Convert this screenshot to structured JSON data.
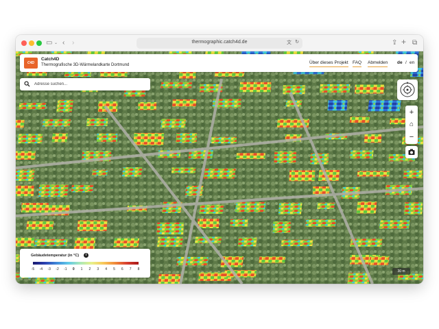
{
  "browser": {
    "url": "thermographic.catch4d.de"
  },
  "header": {
    "logo_text": "C4D",
    "brand": "Catch4D",
    "subtitle": "Thermografische 3D-Wärmelandkarte Dortmund",
    "nav": [
      {
        "label": "Über dieses Projekt"
      },
      {
        "label": "FAQ"
      },
      {
        "label": "Abmelden"
      }
    ],
    "lang": {
      "de": "de",
      "separator": "/",
      "en": "en"
    }
  },
  "search": {
    "placeholder": "Adresse suchen..."
  },
  "controls": {
    "zoom_in": "+",
    "home": "⌂",
    "zoom_out": "−",
    "camera": "●"
  },
  "legend": {
    "title": "Gebäudetemperatur (in °C)",
    "info": "i",
    "ticks": [
      "-5",
      "-4",
      "-3",
      "-2",
      "-1",
      "0",
      "1",
      "2",
      "3",
      "4",
      "5",
      "6",
      "7",
      "8"
    ],
    "gradient_colors": [
      "#1a1a6e",
      "#2b3fb0",
      "#3f88d8",
      "#5fc8e8",
      "#a8e8b8",
      "#e8f08a",
      "#f8c85a",
      "#f08a3a",
      "#d84030",
      "#a81818"
    ]
  },
  "map": {
    "scale_label": "30 m"
  },
  "colors": {
    "accent": "#e8a23a",
    "logo": "#e8642a"
  }
}
